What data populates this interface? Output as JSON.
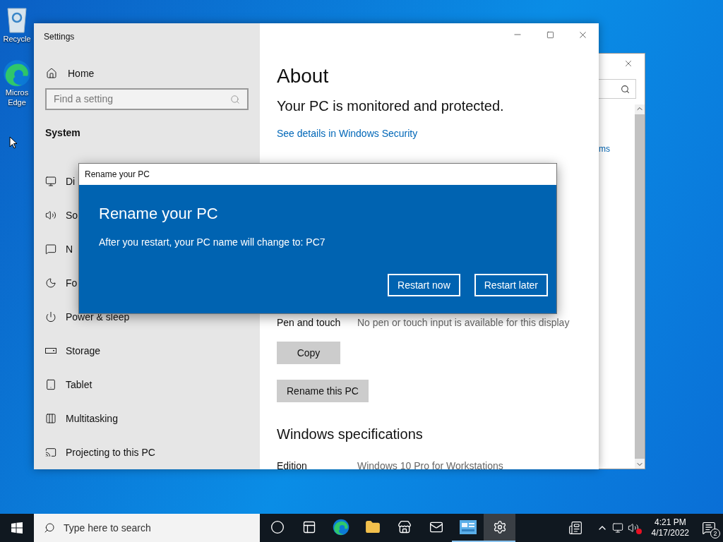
{
  "desktop_icons": [
    {
      "kind": "recycle-bin",
      "lines": [
        "Recycle"
      ]
    },
    {
      "kind": "edge",
      "lines": [
        "Micros",
        "Edge"
      ]
    }
  ],
  "background_window": {
    "link_fragment": "ms"
  },
  "settings": {
    "title": "Settings",
    "home": "Home",
    "search_placeholder": "Find a setting",
    "section": "System",
    "nav": [
      {
        "kind": "display",
        "label": "Di"
      },
      {
        "kind": "sound",
        "label": "So"
      },
      {
        "kind": "notifications",
        "label": "N"
      },
      {
        "kind": "focus",
        "label": "Fo"
      },
      {
        "kind": "power",
        "label": "Power & sleep"
      },
      {
        "kind": "storage",
        "label": "Storage"
      },
      {
        "kind": "tablet",
        "label": "Tablet"
      },
      {
        "kind": "multitasking",
        "label": "Multitasking"
      },
      {
        "kind": "projecting",
        "label": "Projecting to this PC"
      }
    ],
    "content": {
      "title": "About",
      "status": "Your PC is monitored and protected.",
      "link": "See details in Windows Security",
      "rows": [
        {
          "label": "Pen and touch",
          "value": "No pen or touch input is available for this display"
        }
      ],
      "buttons": [
        "Copy",
        "Rename this PC"
      ],
      "specs_title": "Windows specifications",
      "spec_rows": [
        {
          "label": "Edition",
          "value": "Windows 10 Pro for Workstations"
        }
      ]
    }
  },
  "dialog": {
    "window_title": "Rename your PC",
    "heading": "Rename your PC",
    "message": "After you restart, your PC name will change to: PC7",
    "buttons": [
      "Restart now",
      "Restart later"
    ]
  },
  "taskbar": {
    "search_placeholder": "Type here to search",
    "apps": [
      {
        "kind": "cortana",
        "running": false,
        "selected": false
      },
      {
        "kind": "task-view",
        "running": false,
        "selected": false
      },
      {
        "kind": "edge",
        "running": false,
        "selected": false
      },
      {
        "kind": "explorer",
        "running": false,
        "selected": false
      },
      {
        "kind": "store",
        "running": false,
        "selected": false
      },
      {
        "kind": "mail",
        "running": false,
        "selected": false
      },
      {
        "kind": "app",
        "running": true,
        "selected": false
      },
      {
        "kind": "settings",
        "running": true,
        "selected": true
      }
    ],
    "volume_muted": true,
    "time": "4:21 PM",
    "date": "4/17/2022",
    "notification_count": "2"
  }
}
